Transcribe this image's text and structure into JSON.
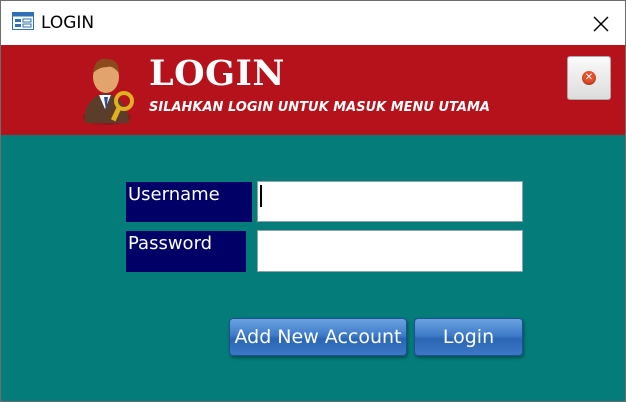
{
  "window": {
    "title": "LOGIN"
  },
  "header": {
    "title": "LOGIN",
    "subtitle": "SILAHKAN LOGIN UNTUK MASUK MENU UTAMA",
    "bg_color": "#b5121b"
  },
  "form": {
    "username_label": "Username",
    "username_value": "",
    "password_label": "Password",
    "password_value": "",
    "bg_color": "#047c7a",
    "label_color": "#000066"
  },
  "buttons": {
    "add_account_label": "Add New Account",
    "login_label": "Login"
  },
  "icons": {
    "app": "form-icon",
    "window_close": "close-icon",
    "header": "user-key-icon",
    "header_close": "close-circle-icon"
  }
}
